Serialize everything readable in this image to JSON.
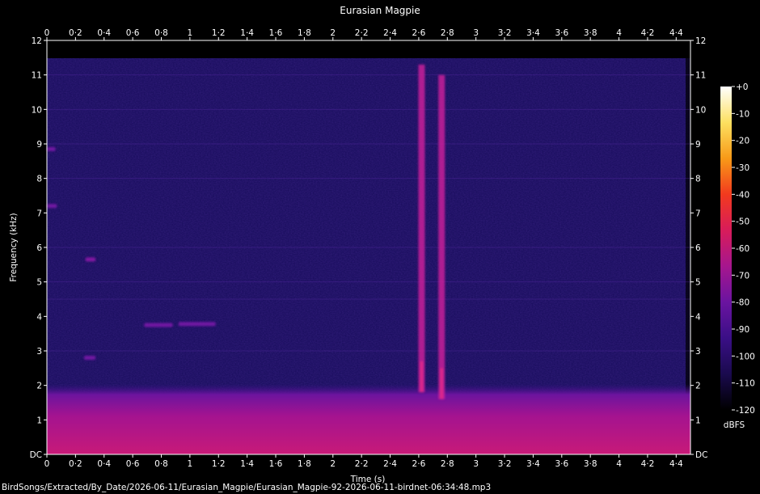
{
  "chart_data": {
    "type": "heatmap",
    "title": "Eurasian Magpie",
    "xlabel": "Time (s)",
    "ylabel": "Frequency (kHz)",
    "xlim": [
      0,
      4.5
    ],
    "ylim": [
      0,
      12
    ],
    "x_ticks": [
      "0",
      "0·2",
      "0·4",
      "0·6",
      "0·8",
      "1",
      "1·2",
      "1·4",
      "1·6",
      "1·8",
      "2",
      "2·2",
      "2·4",
      "2·6",
      "2·8",
      "3",
      "3·2",
      "3·4",
      "3·6",
      "3·8",
      "4",
      "4·2",
      "4·4"
    ],
    "y_ticks": [
      "DC",
      "1",
      "2",
      "3",
      "4",
      "5",
      "6",
      "7",
      "8",
      "9",
      "10",
      "11",
      "12"
    ],
    "colorbar": {
      "label": "dBFS",
      "ticks": [
        "+0",
        "-10",
        "-20",
        "-30",
        "-40",
        "-50",
        "-60",
        "-70",
        "-80",
        "-90",
        "-100",
        "-110",
        "-120"
      ],
      "range": [
        -120,
        0
      ],
      "colors": [
        "#000000",
        "#1a0a4e",
        "#3a0f86",
        "#6a14a0",
        "#a6168e",
        "#d81c5a",
        "#f23a1e",
        "#f89a18",
        "#fde060",
        "#ffffff"
      ]
    },
    "noise_floor_band_khz": [
      0,
      1.7
    ],
    "features": [
      {
        "kind": "broadband-click",
        "t": 2.62,
        "f_range": [
          1.8,
          11.3
        ],
        "intensity_db": -68
      },
      {
        "kind": "broadband-click",
        "t": 2.76,
        "f_range": [
          1.6,
          11.0
        ],
        "intensity_db": -70
      },
      {
        "kind": "tone",
        "t_range": [
          0.26,
          0.34
        ],
        "f": 2.8,
        "intensity_db": -80
      },
      {
        "kind": "tone",
        "t_range": [
          0.27,
          0.34
        ],
        "f": 5.65,
        "intensity_db": -78
      },
      {
        "kind": "tone",
        "t_range": [
          0.68,
          0.88
        ],
        "f": 3.75,
        "intensity_db": -80
      },
      {
        "kind": "tone",
        "t_range": [
          0.92,
          1.18
        ],
        "f": 3.78,
        "intensity_db": -80
      },
      {
        "kind": "tone",
        "t_range": [
          0.0,
          0.07
        ],
        "f": 7.2,
        "intensity_db": -84
      },
      {
        "kind": "tone",
        "t_range": [
          0.0,
          0.06
        ],
        "f": 8.85,
        "intensity_db": -86
      }
    ]
  },
  "footer": {
    "file_path": "BirdSongs/Extracted/By_Date/2026-06-11/Eurasian_Magpie/Eurasian_Magpie-92-2026-06-11-birdnet-06:34:48.mp3"
  }
}
